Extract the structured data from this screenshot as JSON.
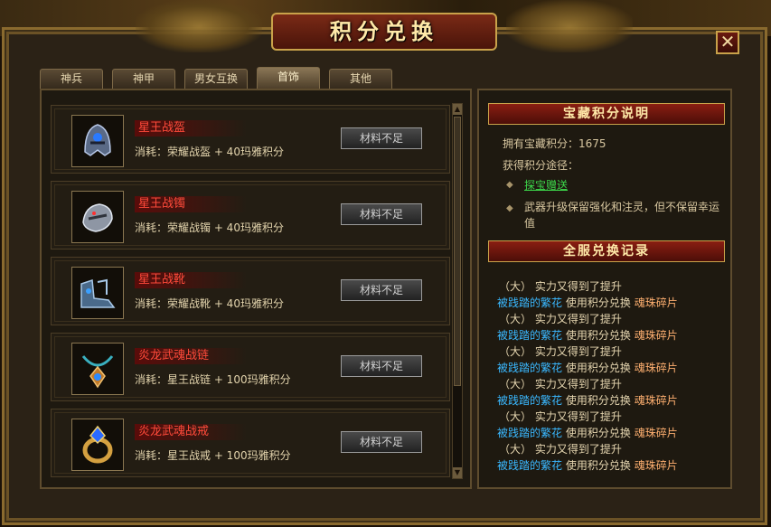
{
  "window": {
    "title": "积分兑换",
    "close": "✕"
  },
  "tabs": [
    {
      "label": "神兵",
      "active": false
    },
    {
      "label": "神甲",
      "active": false
    },
    {
      "label": "男女互换",
      "active": false
    },
    {
      "label": "首饰",
      "active": true
    },
    {
      "label": "其他",
      "active": false
    }
  ],
  "items": [
    {
      "name": "星王战盔",
      "cost": "消耗：荣耀战盔 + 40玛雅积分",
      "button": "材料不足",
      "icon": "helmet-icon"
    },
    {
      "name": "星王战镯",
      "cost": "消耗：荣耀战镯 + 40玛雅积分",
      "button": "材料不足",
      "icon": "bracelet-icon"
    },
    {
      "name": "星王战靴",
      "cost": "消耗：荣耀战靴 + 40玛雅积分",
      "button": "材料不足",
      "icon": "boots-icon"
    },
    {
      "name": "炎龙武魂战链",
      "cost": "消耗：星王战链 + 100玛雅积分",
      "button": "材料不足",
      "icon": "necklace-icon"
    },
    {
      "name": "炎龙武魂战戒",
      "cost": "消耗：星王战戒 + 100玛雅积分",
      "button": "材料不足",
      "icon": "ring-icon"
    }
  ],
  "scroll": {
    "up": "▲",
    "down": "▼"
  },
  "info": {
    "title": "宝藏积分说明",
    "points_line": "拥有宝藏积分：1675",
    "ways_label": "获得积分途径：",
    "way1": "探宝赠送",
    "way2": "武器升级保留强化和注灵，但不保留幸运值",
    "bullet": "◆"
  },
  "records": {
    "title": "全服兑换记录",
    "lines": [
      {
        "k": "（大）",
        "a": "实力又得到了提升"
      },
      {
        "n": "被践踏的繁花",
        "a": "使用积分兑换",
        "p": "魂珠碎片"
      },
      {
        "k": "（大）",
        "a": "实力又得到了提升"
      },
      {
        "n": "被践踏的繁花",
        "a": "使用积分兑换",
        "p": "魂珠碎片"
      },
      {
        "k": "（大）",
        "a": "实力又得到了提升"
      },
      {
        "n": "被践踏的繁花",
        "a": "使用积分兑换",
        "p": "魂珠碎片"
      },
      {
        "k": "（大）",
        "a": "实力又得到了提升"
      },
      {
        "n": "被践踏的繁花",
        "a": "使用积分兑换",
        "p": "魂珠碎片"
      },
      {
        "k": "（大）",
        "a": "实力又得到了提升"
      },
      {
        "n": "被践踏的繁花",
        "a": "使用积分兑换",
        "p": "魂珠碎片"
      },
      {
        "k": "（大）",
        "a": "实力又得到了提升"
      },
      {
        "n": "被践踏的繁花",
        "a": "使用积分兑换",
        "p": "魂珠碎片"
      }
    ]
  },
  "colors": {
    "accent": "#c9a24a",
    "item_name": "#ff4a3a",
    "link": "#3cd64a",
    "player": "#3ab8ff",
    "prize": "#ffb070"
  }
}
